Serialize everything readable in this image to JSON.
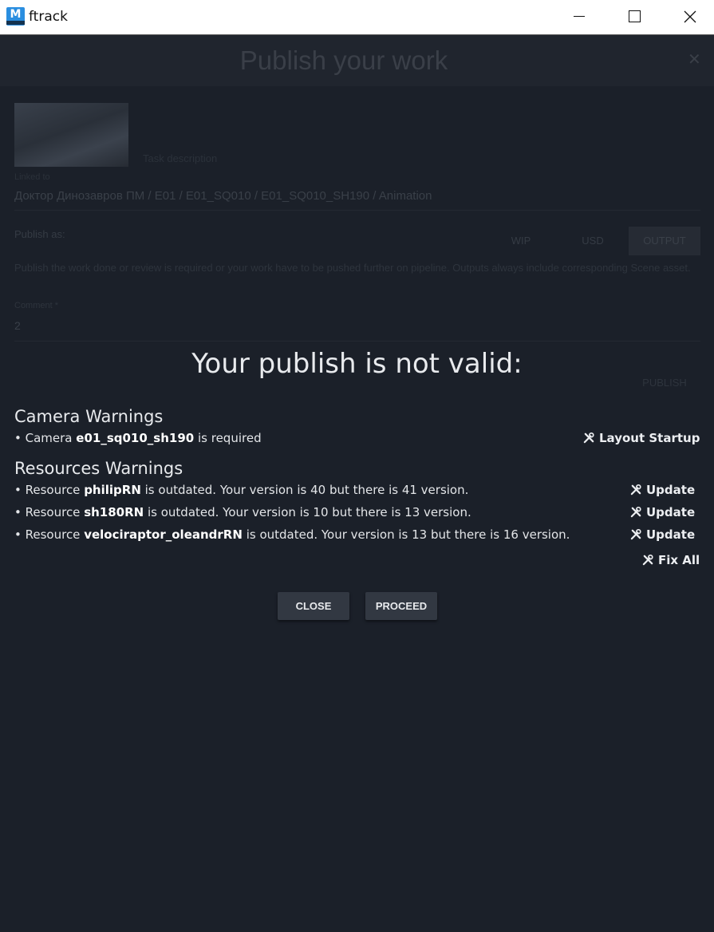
{
  "window": {
    "app_icon_letter": "M",
    "title": "ftrack"
  },
  "dialog": {
    "title": "Publish your work",
    "close_glyph": "✕",
    "task_description_placeholder": "Task description",
    "linked_to_label": "Linked to",
    "linked_path": "Доктор Динозавров ПМ / E01 / E01_SQ010 / E01_SQ010_SH190 / Animation",
    "publish_as_label": "Publish as:",
    "publish_options": [
      "WIP",
      "USD",
      "OUTPUT"
    ],
    "selected_option": "OUTPUT",
    "description": "Publish the work done or review is required or your work have to be pushed further on pipeline. Outputs always include corresponding Scene asset.",
    "comment_label": "Comment *",
    "comment_value": "2",
    "publish_button": "PUBLISH"
  },
  "validation": {
    "title": "Your publish is not valid:",
    "camera_section": {
      "title": "Camera Warnings",
      "items": [
        {
          "prefix": "Camera ",
          "name": "e01_sq010_sh190",
          "suffix": " is required",
          "action": "Layout Startup"
        }
      ]
    },
    "resources_section": {
      "title": "Resources Warnings",
      "items": [
        {
          "prefix": "Resource ",
          "name": "philipRN",
          "suffix": " is outdated. Your version is 40 but there is 41 version.",
          "action": "Update"
        },
        {
          "prefix": "Resource ",
          "name": "sh180RN",
          "suffix": " is outdated. Your version is 10 but there is 13 version.",
          "action": "Update"
        },
        {
          "prefix": "Resource ",
          "name": "velociraptor_oleandrRN",
          "suffix": " is outdated. Your version is 13 but there is 16 version.",
          "action": "Update"
        }
      ]
    },
    "fix_all": "Fix All",
    "close_button": "CLOSE",
    "proceed_button": "PROCEED"
  },
  "colors": {
    "background": "#13171e",
    "text": "#e8eaed",
    "button": "#323842"
  }
}
